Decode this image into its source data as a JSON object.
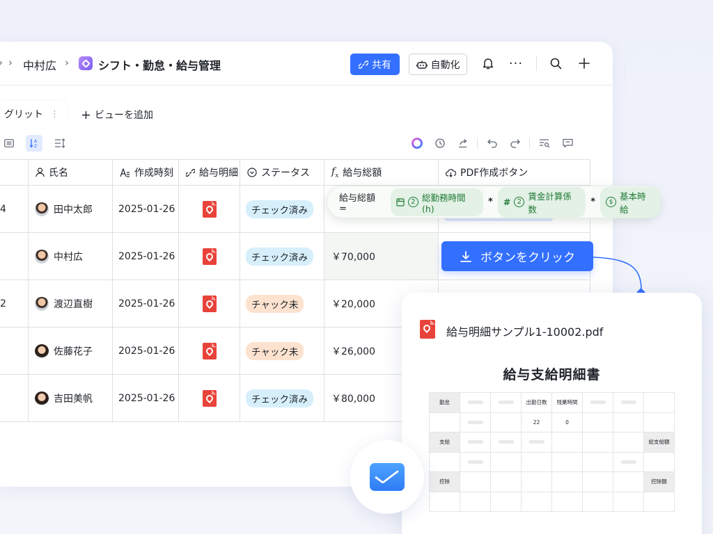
{
  "header": {
    "crumb_parent": "中村広",
    "app_title": "シフト・勤怠・給与管理",
    "share_label": "共有",
    "automation_label": "自動化"
  },
  "tabs": {
    "active_view": "グリット",
    "add_view": "ビューを追加"
  },
  "columns": [
    {
      "label": "氏名",
      "icon": "user-icon"
    },
    {
      "label": "作成時刻",
      "icon": "text-icon"
    },
    {
      "label": "給与明細",
      "icon": "link-icon"
    },
    {
      "label": "ステータス",
      "icon": "status-icon"
    },
    {
      "label": "給与総額",
      "icon": "formula-icon"
    },
    {
      "label": "PDF作成ボタン",
      "icon": "cloud-icon"
    }
  ],
  "rows": [
    {
      "id": "4",
      "name": "田中太郎",
      "created": "2025-01-26",
      "status": "チェック済み",
      "status_type": "done",
      "total": ""
    },
    {
      "id": "",
      "name": "中村広",
      "created": "2025-01-26",
      "status": "チェック済み",
      "status_type": "done",
      "total": "￥70,000"
    },
    {
      "id": "2",
      "name": "渡辺直樹",
      "created": "2025-01-26",
      "status": "チャック未",
      "status_type": "todo",
      "total": "￥20,000"
    },
    {
      "id": "",
      "name": "佐藤花子",
      "created": "2025-01-26",
      "status": "チャック未",
      "status_type": "todo",
      "total": "￥26,000"
    },
    {
      "id": "",
      "name": "吉田美帆",
      "created": "2025-01-26",
      "status": "チェック済み",
      "status_type": "done",
      "total": "￥80,000"
    }
  ],
  "formula": {
    "lhs": "給与総額 =",
    "term1": "総勤務時間(h)",
    "term2": "賃金計算係数",
    "term3": "基本時給",
    "op": "*",
    "num": "2"
  },
  "click_button": "ボタンをクリック",
  "pdf": {
    "filename": "給与明細サンプル1-10002.pdf",
    "title": "給与支給明細書",
    "row_labels": [
      "勤怠",
      "支給",
      "控除"
    ],
    "headers": [
      "出勤日数",
      "残業時間"
    ],
    "values": [
      "22",
      "0"
    ],
    "total_pay": "総支給額",
    "total_deduct": "控除額"
  },
  "colors": {
    "accent": "#3370ff",
    "pdf_red": "#e8433a",
    "status_done": "#d6effb",
    "status_todo": "#fde3cf",
    "formula_green": "#1f7a35"
  }
}
